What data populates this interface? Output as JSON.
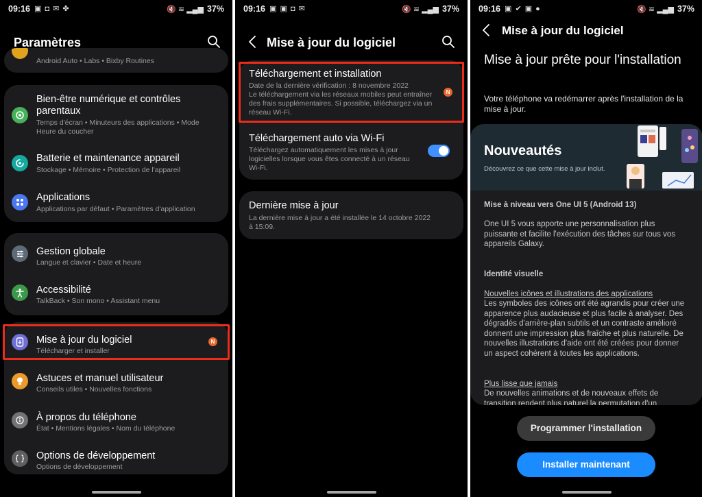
{
  "status": {
    "p1_time": "09:16",
    "p2_time": "09:16",
    "p3_time": "09:16",
    "battery": "37%"
  },
  "settings_screen": {
    "title": "Paramètres",
    "search_icon": "search-icon",
    "partial_row_sub": "Android Auto  •  Labs  •  Bixby Routines",
    "items": [
      {
        "title": "Bien-être numérique et contrôles parentaux",
        "subtitle": "Temps d'écran  •  Minuteurs des applications  •  Mode Heure du coucher",
        "icon": "digital-wellbeing-icon",
        "color": "#46b15a"
      },
      {
        "title": "Batterie et maintenance appareil",
        "subtitle": "Stockage  •  Mémoire  •  Protection de l'appareil",
        "icon": "battery-care-icon",
        "color": "#15a9a0"
      },
      {
        "title": "Applications",
        "subtitle": "Applications par défaut  •  Paramètres d'application",
        "icon": "apps-grid-icon",
        "color": "#4a78f0"
      },
      {
        "title": "Gestion globale",
        "subtitle": "Langue et clavier  •  Date et heure",
        "icon": "sliders-icon",
        "color": "#5e6a78"
      },
      {
        "title": "Accessibilité",
        "subtitle": "TalkBack  •  Son mono  •  Assistant menu",
        "icon": "accessibility-icon",
        "color": "#3b9a49"
      },
      {
        "title": "Mise à jour du logiciel",
        "subtitle": "Télécharger et installer",
        "icon": "software-update-icon",
        "color": "#6f6fd6",
        "badge": "N"
      },
      {
        "title": "Astuces et manuel utilisateur",
        "subtitle": "Conseils utiles  •  Nouvelles fonctions",
        "icon": "lightbulb-icon",
        "color": "#eb9a2a"
      },
      {
        "title": "À propos du téléphone",
        "subtitle": "État  •  Mentions légales  •  Nom du téléphone",
        "icon": "info-icon",
        "color": "#737373"
      },
      {
        "title": "Options de développement",
        "subtitle": "Options de développement",
        "icon": "braces-icon",
        "color": "#5f5f5f"
      }
    ]
  },
  "update_screen": {
    "title": "Mise à jour du logiciel",
    "download": {
      "title": "Téléchargement et installation",
      "subtitle": "Date de la dernière vérification : 8 novembre 2022",
      "subtitle2": "Le téléchargement via les réseaux mobiles peut entraîner des frais supplémentaires. Si possible, téléchargez via un réseau Wi-Fi.",
      "badge": "N"
    },
    "auto_wifi": {
      "title": "Téléchargement auto via Wi-Fi",
      "subtitle": "Téléchargez automatiquement les mises à jour logicielles lorsque vous êtes connecté à un réseau Wi-Fi.",
      "enabled": true
    },
    "last_update": {
      "title": "Dernière mise à jour",
      "subtitle": "La dernière mise à jour a été installée le 14 octobre 2022 à 15:09."
    }
  },
  "ready_screen": {
    "title": "Mise à jour du logiciel",
    "heading": "Mise à jour prête pour l'installation",
    "description": "Votre téléphone va redémarrer après l'installation de la mise à jour.",
    "notes": {
      "banner_title": "Nouveautés",
      "banner_subtitle": "Découvrez ce que cette mise à jour inclut.",
      "version": "Mise à niveau vers One UI 5 (Android 13)",
      "intro": "One UI 5 vous apporte une personnalisation plus puissante et facilite l'exécution des tâches sur tous vos appareils Galaxy.",
      "section1": "Identité visuelle",
      "sub1": "Nouvelles icônes et illustrations des applications",
      "para1": "Les symboles des icônes ont été agrandis pour créer une apparence plus audacieuse et plus facile à analyser. Des dégradés d'arrière-plan subtils et un contraste amélioré donnent une impression plus fraîche et plus naturelle. De nouvelles illustrations d'aide ont été créées pour donner un aspect cohérent à toutes les applications.",
      "sub2": "Plus lisse que jamais",
      "para2": "De nouvelles animations et de nouveaux effets de transition rendent plus naturel la permutation d'un"
    },
    "schedule_button": "Programmer l'installation",
    "install_button": "Installer maintenant"
  }
}
